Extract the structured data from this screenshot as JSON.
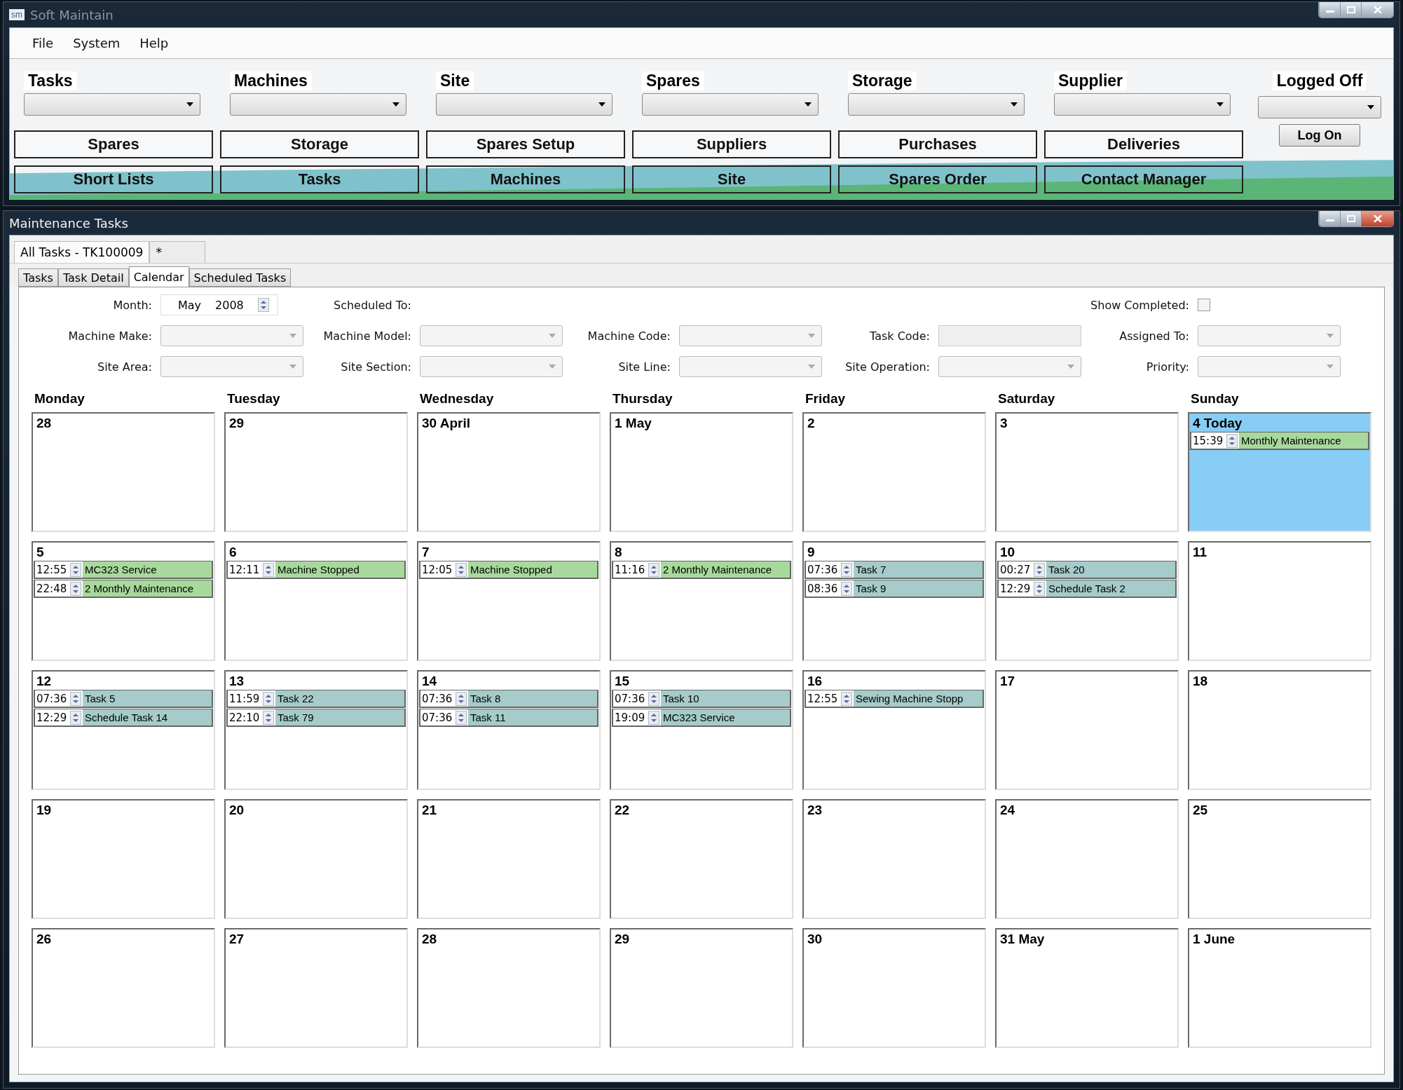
{
  "app_window": {
    "title": "Soft Maintain",
    "logo": "sm",
    "menu": [
      "File",
      "System",
      "Help"
    ],
    "dropdowns": [
      {
        "label": "Tasks"
      },
      {
        "label": "Machines"
      },
      {
        "label": "Site"
      },
      {
        "label": "Spares"
      },
      {
        "label": "Storage"
      },
      {
        "label": "Supplier"
      }
    ],
    "login": {
      "label": "Logged Off",
      "button": "Log On"
    },
    "nav_rows": [
      {
        "kind": "plain",
        "buttons": [
          "Spares",
          "Storage",
          "Spares Setup",
          "Suppliers",
          "Purchases",
          "Deliveries"
        ]
      },
      {
        "kind": "wave",
        "buttons": [
          "Short Lists",
          "Tasks",
          "Machines",
          "Site",
          "Spares Order",
          "Contact Manager"
        ]
      }
    ]
  },
  "tasks_window": {
    "title": "Maintenance Tasks",
    "doc_tabs": [
      {
        "label": "All Tasks - TK100009",
        "selected": true
      },
      {
        "label": "*",
        "selected": false
      }
    ],
    "tabs": [
      {
        "label": "Tasks",
        "selected": false
      },
      {
        "label": "Task Detail",
        "selected": false
      },
      {
        "label": "Calendar",
        "selected": true
      },
      {
        "label": "Scheduled Tasks",
        "selected": false
      }
    ],
    "filters": {
      "month": {
        "label": "Month:",
        "month": "May",
        "year": "2008"
      },
      "scheduled_to": {
        "label": "Scheduled To:"
      },
      "show_completed": {
        "label": "Show Completed:",
        "checked": false
      },
      "fields": [
        {
          "label": "Machine Make:",
          "kind": "combo"
        },
        {
          "label": "Machine Model:",
          "kind": "combo"
        },
        {
          "label": "Machine Code:",
          "kind": "combo"
        },
        {
          "label": "Task Code:",
          "kind": "text"
        },
        {
          "label": "Assigned To:",
          "kind": "combo"
        },
        {
          "label": "Site Area:",
          "kind": "combo"
        },
        {
          "label": "Site Section:",
          "kind": "combo"
        },
        {
          "label": "Site Line:",
          "kind": "combo"
        },
        {
          "label": "Site Operation:",
          "kind": "combo"
        },
        {
          "label": "Priority:",
          "kind": "combo"
        }
      ]
    },
    "calendar": {
      "weekdays": [
        "Monday",
        "Tuesday",
        "Wednesday",
        "Thursday",
        "Friday",
        "Saturday",
        "Sunday"
      ],
      "weeks": [
        [
          {
            "label": "28",
            "today": false
          },
          {
            "label": "29",
            "today": false
          },
          {
            "label": "30 April",
            "today": false
          },
          {
            "label": "1 May",
            "today": false
          },
          {
            "label": "2",
            "today": false
          },
          {
            "label": "3",
            "today": false
          },
          {
            "label": "4 Today",
            "today": true,
            "events": [
              {
                "time": "15:39",
                "title": "Monthly Maintenance",
                "color": "#a8d99c"
              }
            ]
          }
        ],
        [
          {
            "label": "5",
            "today": false,
            "events": [
              {
                "time": "12:55",
                "title": "MC323 Service",
                "color": "#a8d99c"
              },
              {
                "time": "22:48",
                "title": "2 Monthly Maintenance",
                "color": "#a8d99c"
              }
            ]
          },
          {
            "label": "6",
            "today": false,
            "events": [
              {
                "time": "12:11",
                "title": "Machine Stopped",
                "color": "#a8d99c"
              }
            ]
          },
          {
            "label": "7",
            "today": false,
            "events": [
              {
                "time": "12:05",
                "title": "Machine Stopped",
                "color": "#a8d99c"
              }
            ]
          },
          {
            "label": "8",
            "today": false,
            "events": [
              {
                "time": "11:16",
                "title": "2 Monthly Maintenance",
                "color": "#a8d99c"
              }
            ]
          },
          {
            "label": "9",
            "today": false,
            "events": [
              {
                "time": "07:36",
                "title": "Task 7",
                "color": "#a5cbca"
              },
              {
                "time": "08:36",
                "title": "Task 9",
                "color": "#a5cbca"
              }
            ]
          },
          {
            "label": "10",
            "today": false,
            "events": [
              {
                "time": "00:27",
                "title": "Task 20",
                "color": "#a5cbca"
              },
              {
                "time": "12:29",
                "title": "Schedule Task 2",
                "color": "#a5cbca"
              }
            ]
          },
          {
            "label": "11",
            "today": false
          }
        ],
        [
          {
            "label": "12",
            "today": false,
            "events": [
              {
                "time": "07:36",
                "title": "Task 5",
                "color": "#a5cbca"
              },
              {
                "time": "12:29",
                "title": "Schedule Task 14",
                "color": "#a5cbca"
              }
            ]
          },
          {
            "label": "13",
            "today": false,
            "events": [
              {
                "time": "11:59",
                "title": "Task 22",
                "color": "#a5cbca"
              },
              {
                "time": "22:10",
                "title": "Task 79",
                "color": "#a5cbca"
              }
            ]
          },
          {
            "label": "14",
            "today": false,
            "events": [
              {
                "time": "07:36",
                "title": "Task 8",
                "color": "#a5cbca"
              },
              {
                "time": "07:36",
                "title": "Task 11",
                "color": "#a5cbca"
              }
            ]
          },
          {
            "label": "15",
            "today": false,
            "events": [
              {
                "time": "07:36",
                "title": "Task 10",
                "color": "#a5cbca"
              },
              {
                "time": "19:09",
                "title": "MC323 Service",
                "color": "#a5cbca"
              }
            ]
          },
          {
            "label": "16",
            "today": false,
            "events": [
              {
                "time": "12:55",
                "title": "Sewing Machine Stopp",
                "color": "#a5cbca"
              }
            ]
          },
          {
            "label": "17",
            "today": false
          },
          {
            "label": "18",
            "today": false
          }
        ],
        [
          {
            "label": "19",
            "today": false
          },
          {
            "label": "20",
            "today": false
          },
          {
            "label": "21",
            "today": false
          },
          {
            "label": "22",
            "today": false
          },
          {
            "label": "23",
            "today": false
          },
          {
            "label": "24",
            "today": false
          },
          {
            "label": "25",
            "today": false
          }
        ],
        [
          {
            "label": "26",
            "today": false
          },
          {
            "label": "27",
            "today": false
          },
          {
            "label": "28",
            "today": false
          },
          {
            "label": "29",
            "today": false
          },
          {
            "label": "30",
            "today": false
          },
          {
            "label": "31 May",
            "today": false
          },
          {
            "label": "1 June",
            "today": false
          }
        ]
      ]
    }
  }
}
